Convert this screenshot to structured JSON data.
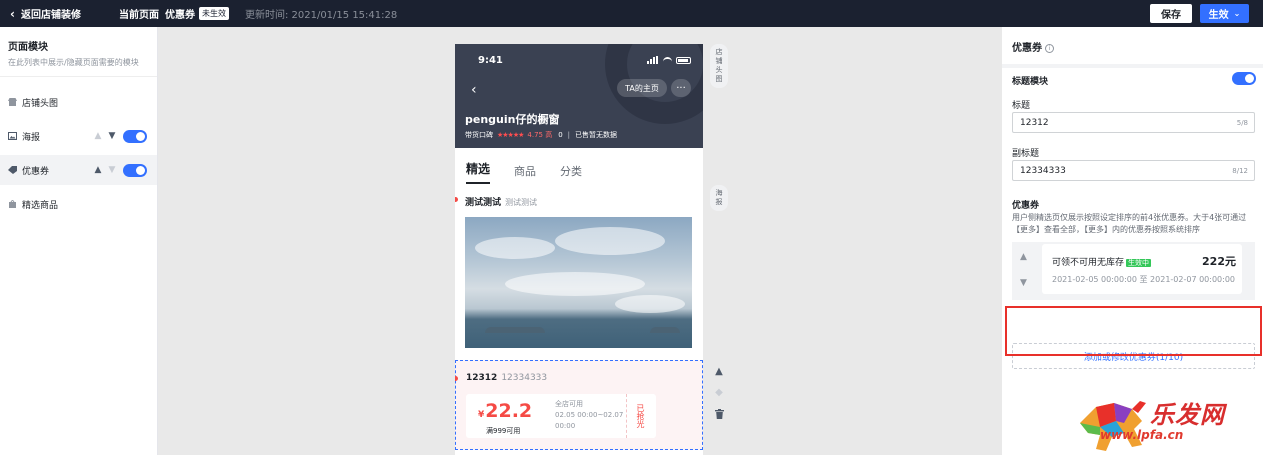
{
  "topbar": {
    "back_label": "返回店铺装修",
    "current_page_label": "当前页面",
    "current_page_value": "优惠券",
    "status_badge": "未生效",
    "updated_time": "更新时间: 2021/01/15 15:41:28",
    "save_label": "保存",
    "publish_label": "生效"
  },
  "left_panel": {
    "title": "页面模块",
    "subtitle": "在此列表中展示/隐藏页面需要的模块",
    "modules": [
      {
        "label": "店铺头图"
      },
      {
        "label": "海报"
      },
      {
        "label": "优惠券"
      },
      {
        "label": "精选商品"
      }
    ]
  },
  "phone": {
    "time": "9:41",
    "ta_home": "TA的主页",
    "more": "···",
    "shop_name": "penguin仔的橱窗",
    "reputation_label": "带货口碑",
    "stars": "★★★★★",
    "score": "4.75 高",
    "sales_count": "0",
    "sold_label": "已售暂无数据",
    "tabs": [
      "精选",
      "商品",
      "分类"
    ],
    "featured_title": "测试测试",
    "featured_sub": "测试测试",
    "coupon_block_title": "12312",
    "coupon_block_sub": "12334333",
    "coupon": {
      "currency": "¥",
      "amount": "22.2",
      "condition": "满999可用",
      "scope": "全店可用",
      "date_range": "02.05 00:00~02.07",
      "date_end_time": "00:00",
      "status": "已抢光"
    }
  },
  "side_tags": {
    "header_tag": "店铺头图",
    "poster_tag": "海报"
  },
  "right_panel": {
    "title": "优惠券",
    "title_block_label": "标题模块",
    "title_label": "标题",
    "title_value": "12312",
    "title_count": "5/8",
    "subtitle_label": "副标题",
    "subtitle_value": "12334333",
    "subtitle_count": "8/12",
    "coupon_section_label": "优惠券",
    "coupon_desc_1": "用户侧精选页仅展示按照设定排序的前4张优惠券。大于4张可通过",
    "coupon_desc_2": "【更多】查看全部，【更多】内的优惠券按照系统排序",
    "coupon_item": {
      "name": "可领不可用无库存",
      "tag": "生效中",
      "amount": "222元",
      "date": "2021-02-05 00:00:00 至 2021-02-07 00:00:00"
    },
    "add_button": "添加或修改优惠券(1/10)"
  },
  "watermark": {
    "text": "乐发网",
    "url": "www.lpfa.cn"
  },
  "colors": {
    "topbar_bg": "#1b2130",
    "accent": "#3370ff",
    "price_red": "#f54a45",
    "highlight_red": "#e8302a"
  }
}
